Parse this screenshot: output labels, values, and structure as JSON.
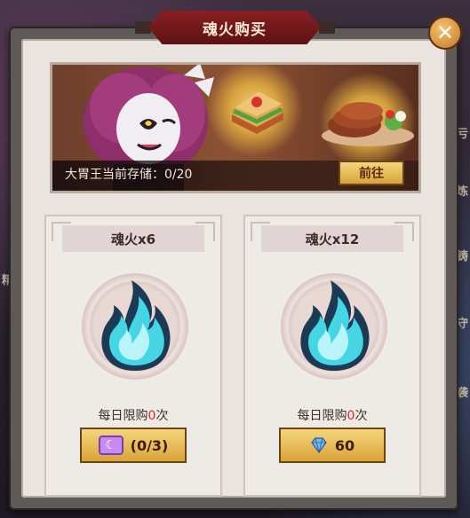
{
  "popup": {
    "title": "魂火购买",
    "close_symbol": "✕"
  },
  "banner": {
    "storage_label": "大胃王当前存储：0/20",
    "go_button": "前往"
  },
  "cards": [
    {
      "title": "魂火x6",
      "limit_prefix": "每日限购",
      "limit_count": "0",
      "limit_suffix": "次",
      "price_icon": "moon-ticket-icon",
      "price": "(0/3)"
    },
    {
      "title": "魂火x12",
      "limit_prefix": "每日限购",
      "limit_count": "0",
      "limit_suffix": "次",
      "price_icon": "diamond-icon",
      "price": "60"
    }
  ],
  "colors": {
    "accent_gold": "#d9a43a",
    "title_red": "#8a1f22",
    "limit_red": "#e02424",
    "flame_cyan": "#45d6e6"
  }
}
